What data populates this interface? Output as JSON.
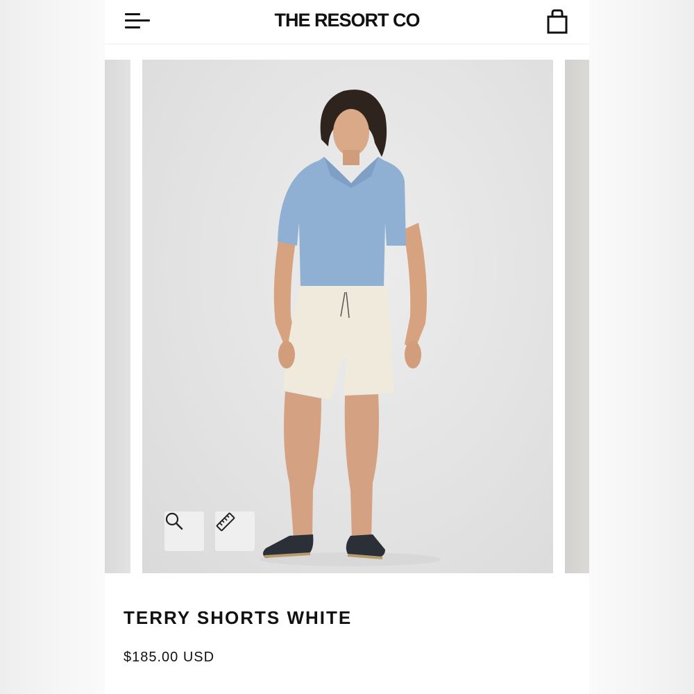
{
  "header": {
    "brand": "THE RESORT CO",
    "icons": [
      "menu-icon",
      "shopping-bag-icon"
    ]
  },
  "gallery": {
    "image_alt": "Model wearing light blue linen polo and white terry shorts with navy espadrilles",
    "tools": [
      "zoom-icon",
      "size-guide-ruler-icon"
    ]
  },
  "product": {
    "title": "TERRY SHORTS WHITE",
    "price": "$185.00 USD"
  },
  "colors": {
    "text": "#111111",
    "shirt": "#8fb0d3",
    "shorts": "#efeadb",
    "shoes": "#2b2f38",
    "backdrop": "#e4e4e4"
  }
}
